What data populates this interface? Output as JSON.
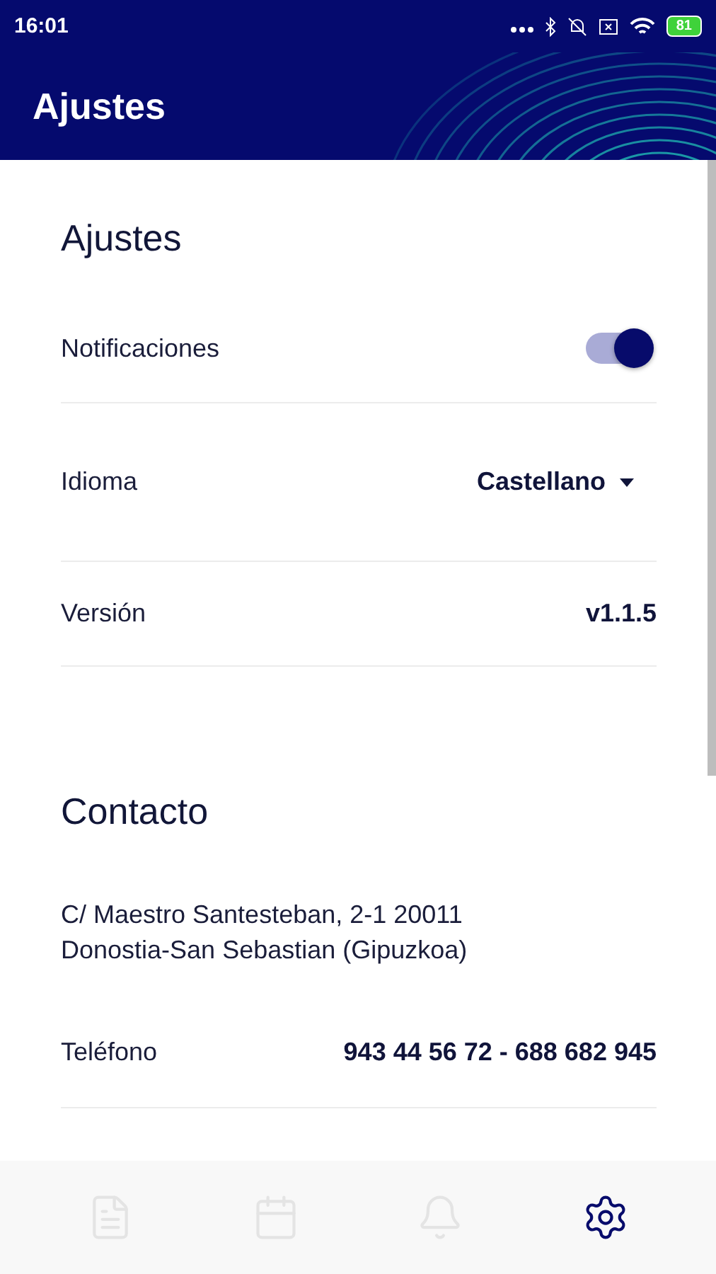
{
  "status_bar": {
    "time": "16:01",
    "battery": "81"
  },
  "app_bar": {
    "title": "Ajustes"
  },
  "settings": {
    "title": "Ajustes",
    "items": [
      {
        "kind": "toggle",
        "label": "Notificaciones",
        "on": true
      },
      {
        "kind": "select",
        "label": "Idioma",
        "value": "Castellano"
      },
      {
        "kind": "value",
        "label": "Versión",
        "value": "v1.1.5"
      }
    ]
  },
  "contact": {
    "title": "Contacto",
    "address": [
      "C/ Maestro Santesteban, 2-1 20011",
      "Donostia-San Sebastian (Gipuzkoa)"
    ],
    "items": [
      {
        "kind": "value",
        "label": "Teléfono",
        "value": "943 44 56 72 - 688 682 945"
      }
    ]
  },
  "bottom_nav": [
    {
      "kind": "news",
      "selected": false
    },
    {
      "kind": "calendar",
      "selected": false
    },
    {
      "kind": "alerts",
      "selected": false
    },
    {
      "kind": "settings",
      "selected": true
    }
  ]
}
